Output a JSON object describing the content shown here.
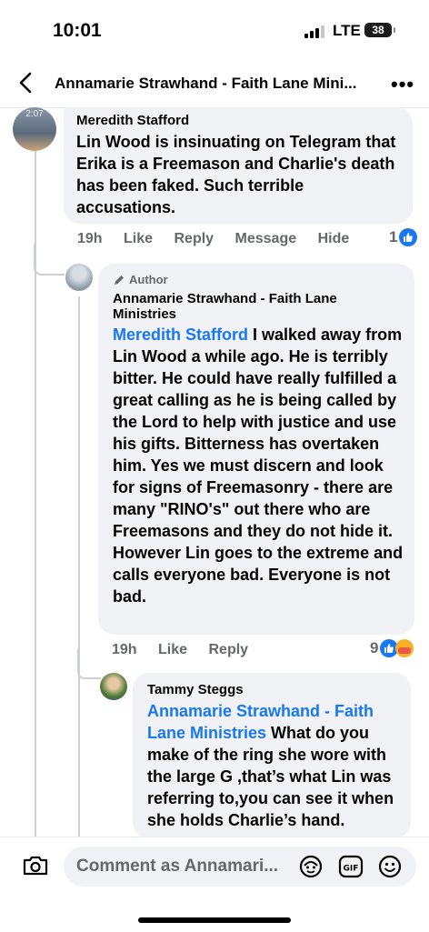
{
  "status": {
    "time": "10:01",
    "network": "LTE",
    "battery": "38"
  },
  "header": {
    "title": "Annamarie Strawhand - Faith Lane Mini...",
    "more": "•••"
  },
  "comments": [
    {
      "author": "Meredith Stafford",
      "avatar_text": "2:07",
      "text": "Lin Wood is insinuating on Telegram that Erika is a Freemason and Charlie's death has been faked. Such terrible accusations.",
      "time": "19h",
      "like": "Like",
      "reply": "Reply",
      "message": "Message",
      "hide": "Hide",
      "reactions": "1"
    },
    {
      "badge": "Author",
      "author": "Annamarie Strawhand - Faith Lane Ministries",
      "mention": "Meredith Stafford",
      "text": " I walked away from Lin Wood a while ago. He is terribly bitter.  He could have really fulfilled a great calling as he is being called by the Lord to help with justice and use his gifts.  Bitterness has overtaken him.  Yes we must discern and look for signs of Freemasonry - there are many \"RINO's\" out there who are Freemasons and they do not hide it.  However Lin goes to the extreme and calls everyone bad.  Everyone is not bad.",
      "time": "19h",
      "like": "Like",
      "reply": "Reply",
      "reactions": "9"
    },
    {
      "author": "Tammy Steggs",
      "mention": "Annamarie Strawhand - Faith Lane Ministries",
      "text": "  What do you make of the ring she wore with the large G ,that’s what Lin was referring to,you can see it when she holds Charlie’s hand."
    }
  ],
  "composer": {
    "placeholder": "Comment as Annamari..."
  },
  "colors": {
    "accent": "#1877f2",
    "bubble": "#f0f2f5",
    "muted": "#65676b"
  }
}
